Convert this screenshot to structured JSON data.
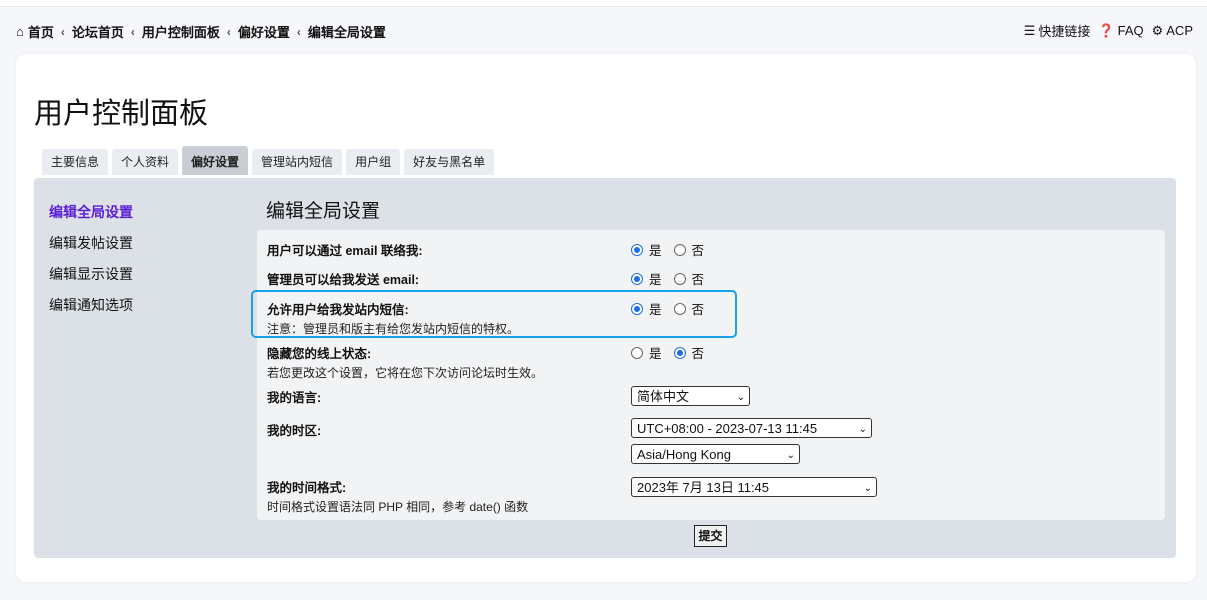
{
  "breadcrumb": {
    "items": [
      "首页",
      "论坛首页",
      "用户控制面板",
      "偏好设置",
      "编辑全局设置"
    ]
  },
  "quick_links": {
    "quick": "快捷链接",
    "faq": "FAQ",
    "acp": "ACP"
  },
  "page": {
    "title": "用户控制面板"
  },
  "tabs": [
    {
      "label": "主要信息",
      "active": false
    },
    {
      "label": "个人资料",
      "active": false
    },
    {
      "label": "偏好设置",
      "active": true
    },
    {
      "label": "管理站内短信",
      "active": false
    },
    {
      "label": "用户组",
      "active": false
    },
    {
      "label": "好友与黑名单",
      "active": false
    }
  ],
  "sidemenu": [
    {
      "label": "编辑全局设置",
      "active": true
    },
    {
      "label": "编辑发帖设置",
      "active": false
    },
    {
      "label": "编辑显示设置",
      "active": false
    },
    {
      "label": "编辑通知选项",
      "active": false
    }
  ],
  "form": {
    "title": "编辑全局设置",
    "yes": "是",
    "no": "否",
    "rows": [
      {
        "label": "用户可以通过 email 联络我:",
        "note": "",
        "selected": "yes"
      },
      {
        "label": "管理员可以给我发送 email:",
        "note": "",
        "selected": "yes"
      },
      {
        "label": "允许用户给我发站内短信:",
        "note": "注意：管理员和版主有给您发站内短信的特权。",
        "selected": "yes"
      },
      {
        "label": "隐藏您的线上状态:",
        "note": "若您更改这个设置，它将在您下次访问论坛时生效。",
        "selected": "no"
      }
    ],
    "language_label": "我的语言:",
    "language_value": "简体中文",
    "timezone_label": "我的时区:",
    "timezone_value": "UTC+08:00 - 2023-07-13 11:45",
    "timezone_city": "Asia/Hong Kong",
    "dateformat_label": "我的时间格式:",
    "dateformat_note": "时间格式设置语法同 PHP 相同，参考 date() 函数",
    "dateformat_value": "2023年 7月 13日 11:45",
    "submit": "提交"
  },
  "colors": {
    "accent": "#1a6fe8",
    "highlight": "#18a0e8",
    "active_menu": "#5b1fd6"
  }
}
